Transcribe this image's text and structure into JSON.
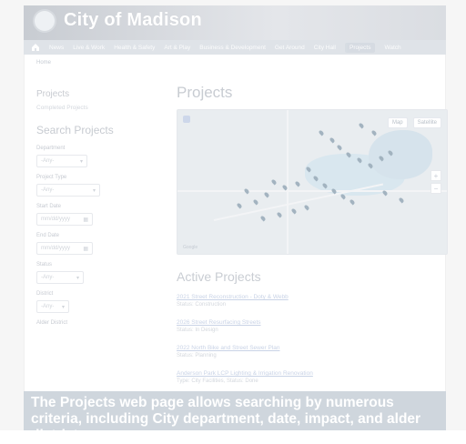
{
  "site": {
    "brand": "City of Madison"
  },
  "nav": {
    "home_icon": "home-icon",
    "items": [
      "News",
      "Live & Work",
      "Health & Safety",
      "Art & Play",
      "Business & Development",
      "Get Around",
      "City Hall",
      "Projects",
      "Watch"
    ],
    "active": "Projects"
  },
  "breadcrumb": {
    "text": "Home"
  },
  "sidebar": {
    "title": "Projects",
    "link": "Completed Projects",
    "search_title": "Search Projects",
    "fields": [
      {
        "label": "Department",
        "value": "-Any-",
        "icon": "chevron-down-icon"
      },
      {
        "label": "Project Type",
        "value": "-Any-",
        "icon": "chevron-down-icon"
      },
      {
        "label": "Start Date",
        "value": "mm/dd/yyyy",
        "icon": "calendar-icon"
      },
      {
        "label": "End Date",
        "value": "mm/dd/yyyy",
        "icon": "calendar-icon"
      },
      {
        "label": "Status",
        "value": "-Any-",
        "icon": "chevron-down-icon"
      },
      {
        "label": "District",
        "value": "-Any-",
        "icon": "chevron-down-icon"
      },
      {
        "label": "Alder District",
        "value": "",
        "icon": ""
      }
    ]
  },
  "main": {
    "title": "Projects",
    "map": {
      "map_label": "Map",
      "satellite_label": "Satellite",
      "zoom_in": "+",
      "zoom_out": "−",
      "attribution": "Google"
    },
    "active_title": "Active Projects",
    "projects": [
      {
        "title": "2021 Street Reconstruction - Doty & Webb",
        "status": "Status: Construction"
      },
      {
        "title": "2026 Street Resurfacing Streets",
        "status": "Status: In Design"
      },
      {
        "title": "2022 North Bike and Street Sewer Plan",
        "status": "Status: Planning"
      },
      {
        "title": "Anderson Park LCP Lighting & Irrigation Renovation",
        "status": "Type: City Facilities, Status: Done"
      }
    ]
  },
  "banner": {
    "text": "The Projects web page allows searching by numerous criteria, including City department, date, impact, and alder district"
  },
  "colors": {
    "header_gradient": "#c8ccd2",
    "nav": "#dfe3e8",
    "banner": "#cfd6dd"
  }
}
